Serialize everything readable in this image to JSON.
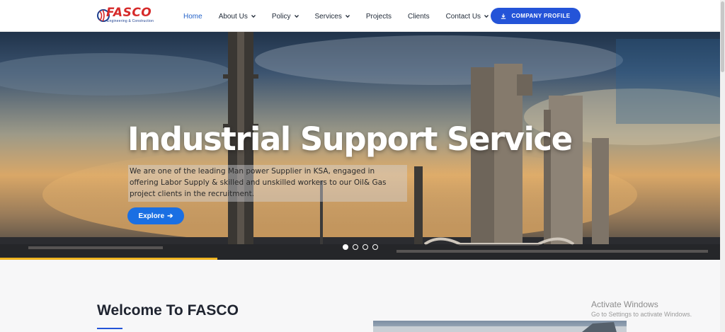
{
  "brand": {
    "name": "FASCO",
    "tagline": "Engineering & Construction",
    "primary_color": "#2454d8",
    "logo_red": "#d62a2a"
  },
  "nav": {
    "items": [
      {
        "label": "Home",
        "has_dropdown": false,
        "active": true
      },
      {
        "label": "About Us",
        "has_dropdown": true,
        "active": false
      },
      {
        "label": "Policy",
        "has_dropdown": true,
        "active": false
      },
      {
        "label": "Services",
        "has_dropdown": true,
        "active": false
      },
      {
        "label": "Projects",
        "has_dropdown": false,
        "active": false
      },
      {
        "label": "Clients",
        "has_dropdown": false,
        "active": false
      },
      {
        "label": "Contact Us",
        "has_dropdown": true,
        "active": false
      }
    ],
    "cta_label": "COMPANY PROFILE",
    "cta_icon": "download-icon"
  },
  "hero": {
    "title": "Industrial Support Service",
    "description": "We are one of the leading Man power Supplier in KSA, engaged in offering Labor Supply & skilled and unskilled workers to our Oil& Gas project clients in the recruitment.",
    "button_label": "Explore",
    "button_icon": "arrow-right-icon",
    "slide_count": 4,
    "active_slide": 1,
    "progress_fraction": 0.3,
    "progress_color": "#f0b420"
  },
  "welcome": {
    "title": "Welcome To FASCO"
  },
  "watermark": {
    "title": "Activate Windows",
    "subtitle": "Go to Settings to activate Windows."
  }
}
